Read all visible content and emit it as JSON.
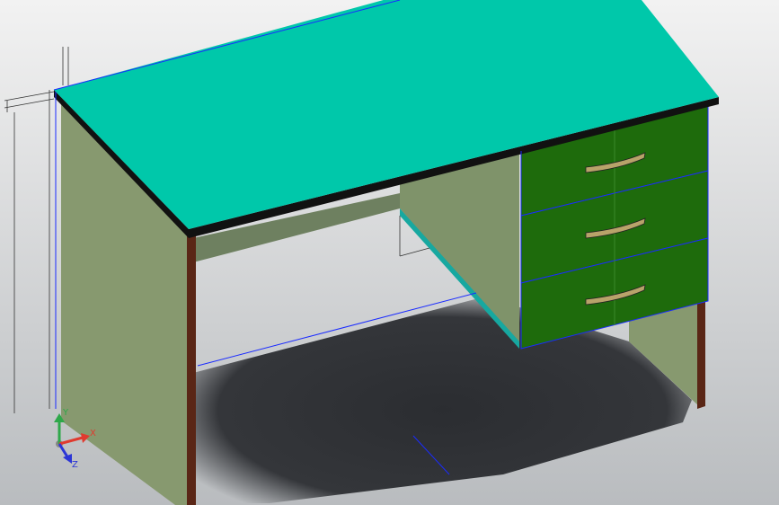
{
  "viewport": {
    "background_top": "#f2f2f2",
    "background_bottom": "#b9bcbf"
  },
  "model": {
    "desktop_color": "#00c8aa",
    "desktop_edge_color": "#111111",
    "side_panel_color": "#7f936a",
    "side_panel_light": "#87996f",
    "back_panel_color": "#6e8060",
    "drawer_front_color": "#1e6b0c",
    "drawer_count": 3,
    "handle_color": "#b8a36a",
    "leg_edge_color": "#5a2616",
    "selection_color": "#1a2bff",
    "shadow_color": "#2b2d31"
  },
  "triad": {
    "x_label": "X",
    "y_label": "Y",
    "z_label": "Z",
    "x_color": "#e03a2f",
    "y_color": "#2ea84a",
    "z_color": "#2c36d6"
  }
}
